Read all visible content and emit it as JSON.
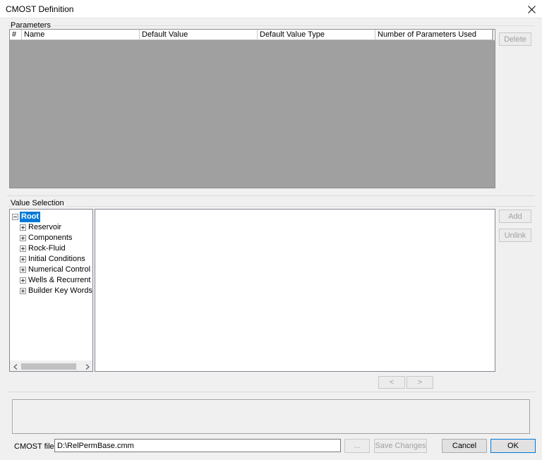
{
  "window": {
    "title": "CMOST Definition"
  },
  "parameters": {
    "section_label": "Parameters",
    "columns": [
      "#",
      "Name",
      "Default Value",
      "Default Value Type",
      "Number of Parameters Used"
    ],
    "delete_label": "Delete"
  },
  "value_selection": {
    "section_label": "Value Selection",
    "tree": {
      "root": "Root",
      "children": [
        "Reservoir",
        "Components",
        "Rock-Fluid",
        "Initial Conditions",
        "Numerical Control",
        "Wells & Recurrent",
        "Builder Key Words"
      ]
    },
    "add_label": "Add",
    "unlink_label": "Unlink",
    "prev_label": "<",
    "next_label": ">"
  },
  "footer": {
    "file_label": "CMOST file:",
    "file_value": "D:\\RelPermBase.cmm",
    "browse_label": "...",
    "save_label": "Save Changes",
    "cancel_label": "Cancel",
    "ok_label": "OK"
  }
}
